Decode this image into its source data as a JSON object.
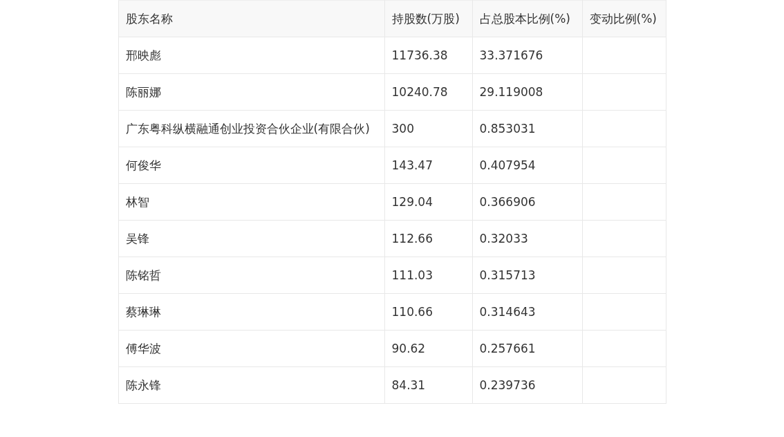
{
  "table": {
    "columns": [
      "股东名称",
      "持股数(万股)",
      "占总股本比例(%)",
      "变动比例(%)"
    ],
    "rows": [
      {
        "name": "邢映彪",
        "shares": "11736.38",
        "ratio": "33.371676"
      },
      {
        "name": "陈丽娜",
        "shares": "10240.78",
        "ratio": "29.119008"
      },
      {
        "name": "广东粤科纵横融通创业投资合伙企业(有限合伙)",
        "shares": "300",
        "ratio": "0.853031"
      },
      {
        "name": "何俊华",
        "shares": "143.47",
        "ratio": "0.407954"
      },
      {
        "name": "林智",
        "shares": "129.04",
        "ratio": "0.366906"
      },
      {
        "name": "吴锋",
        "shares": "112.66",
        "ratio": "0.32033"
      },
      {
        "name": "陈铭哲",
        "shares": "111.03",
        "ratio": "0.315713"
      },
      {
        "name": "蔡琳琳",
        "shares": "110.66",
        "ratio": "0.314643"
      },
      {
        "name": "傅华波",
        "shares": "90.62",
        "ratio": "0.257661"
      },
      {
        "name": "陈永锋",
        "shares": "84.31",
        "ratio": "0.239736"
      }
    ]
  }
}
